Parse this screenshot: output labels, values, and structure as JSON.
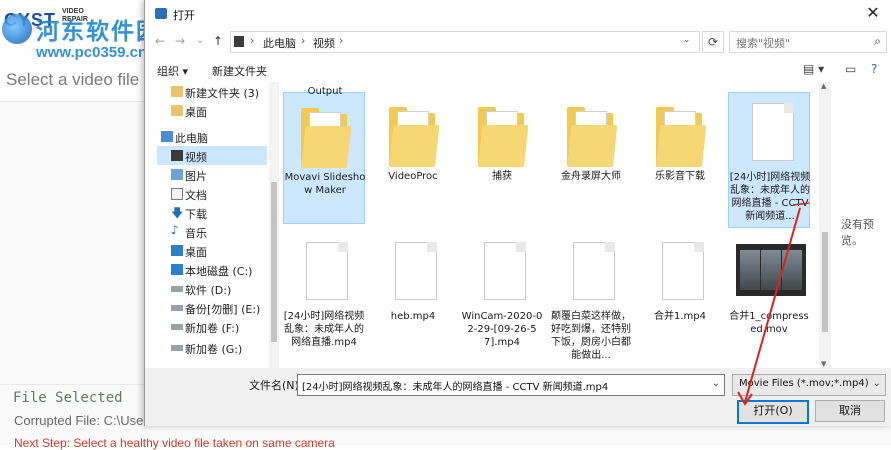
{
  "background_app": {
    "logo_text": "CYST",
    "logo_sub": "VIDEO REPAIR",
    "prompt": "Select a video file t",
    "file_selected": "File Selected",
    "corrupted": "Corrupted File: C:\\Use",
    "next_step": "Next Step: Select a healthy video file taken on same camera"
  },
  "watermark": {
    "title": "河东软件园",
    "url": "www.pc0359.cn"
  },
  "dialog": {
    "title": "打开",
    "close": "✕",
    "nav": {
      "back": "←",
      "forward": "→",
      "dropdown": "⌄",
      "up": "↑"
    },
    "breadcrumb": [
      "此电脑",
      "视频"
    ],
    "search_placeholder": "搜索\"视频\"",
    "toolbar": {
      "organize": "组织 ▾",
      "new_folder": "新建文件夹"
    },
    "nav_pane": [
      {
        "label": "新建文件夹 (3)",
        "icon": "folder-icon"
      },
      {
        "label": "桌面",
        "icon": "folder-icon"
      },
      {
        "label": "此电脑",
        "icon": "computer-icon"
      },
      {
        "label": "视频",
        "icon": "video-icon",
        "selected": true
      },
      {
        "label": "图片",
        "icon": "pictures-icon"
      },
      {
        "label": "文档",
        "icon": "documents-icon"
      },
      {
        "label": "下载",
        "icon": "download-icon"
      },
      {
        "label": "音乐",
        "icon": "music-icon"
      },
      {
        "label": "桌面",
        "icon": "desktop-icon"
      },
      {
        "label": "本地磁盘 (C:)",
        "icon": "drive-icon"
      },
      {
        "label": "软件 (D:)",
        "icon": "drive-icon"
      },
      {
        "label": "备份[勿删] (E:)",
        "icon": "drive-icon"
      },
      {
        "label": "新加卷 (F:)",
        "icon": "drive-icon"
      },
      {
        "label": "新加卷 (G:)",
        "icon": "drive-icon"
      }
    ],
    "files_row1": [
      {
        "name": "Movavi Slideshow Maker",
        "type": "folder",
        "selected": true,
        "above": "Output"
      },
      {
        "name": "VideoProc",
        "type": "folder"
      },
      {
        "name": "捕获",
        "type": "folder"
      },
      {
        "name": "金舟录屏大师",
        "type": "folder"
      },
      {
        "name": "乐影音下载",
        "type": "folder"
      },
      {
        "name": "[24小时]网络视频乱象：未成年人的网络直播 - CCTV 新闻频道...",
        "type": "doc",
        "selected": true
      }
    ],
    "files_row2": [
      {
        "name": "[24小时]网络视频乱象：未成年人的网络直播.mp4",
        "type": "doc"
      },
      {
        "name": "heb.mp4",
        "type": "doc"
      },
      {
        "name": "WinCam-2020-02-29-[09-26-57].mp4",
        "type": "doc"
      },
      {
        "name": "颠覆白菜这样做，好吃到爆，还特别下饭，厨房小白都能做出...",
        "type": "doc"
      },
      {
        "name": "合并1.mp4",
        "type": "doc"
      },
      {
        "name": "合并1_compressed.mov",
        "type": "video"
      }
    ],
    "preview_text": "没有预览。",
    "filename_label": "文件名(N):",
    "filename_value": "[24小时]网络视频乱象：未成年人的网络直播 - CCTV 新闻频道.mp4",
    "filter_value": "Movie Files (*.mov;*.mp4)",
    "open_button": "打开(O)",
    "cancel_button": "取消"
  }
}
